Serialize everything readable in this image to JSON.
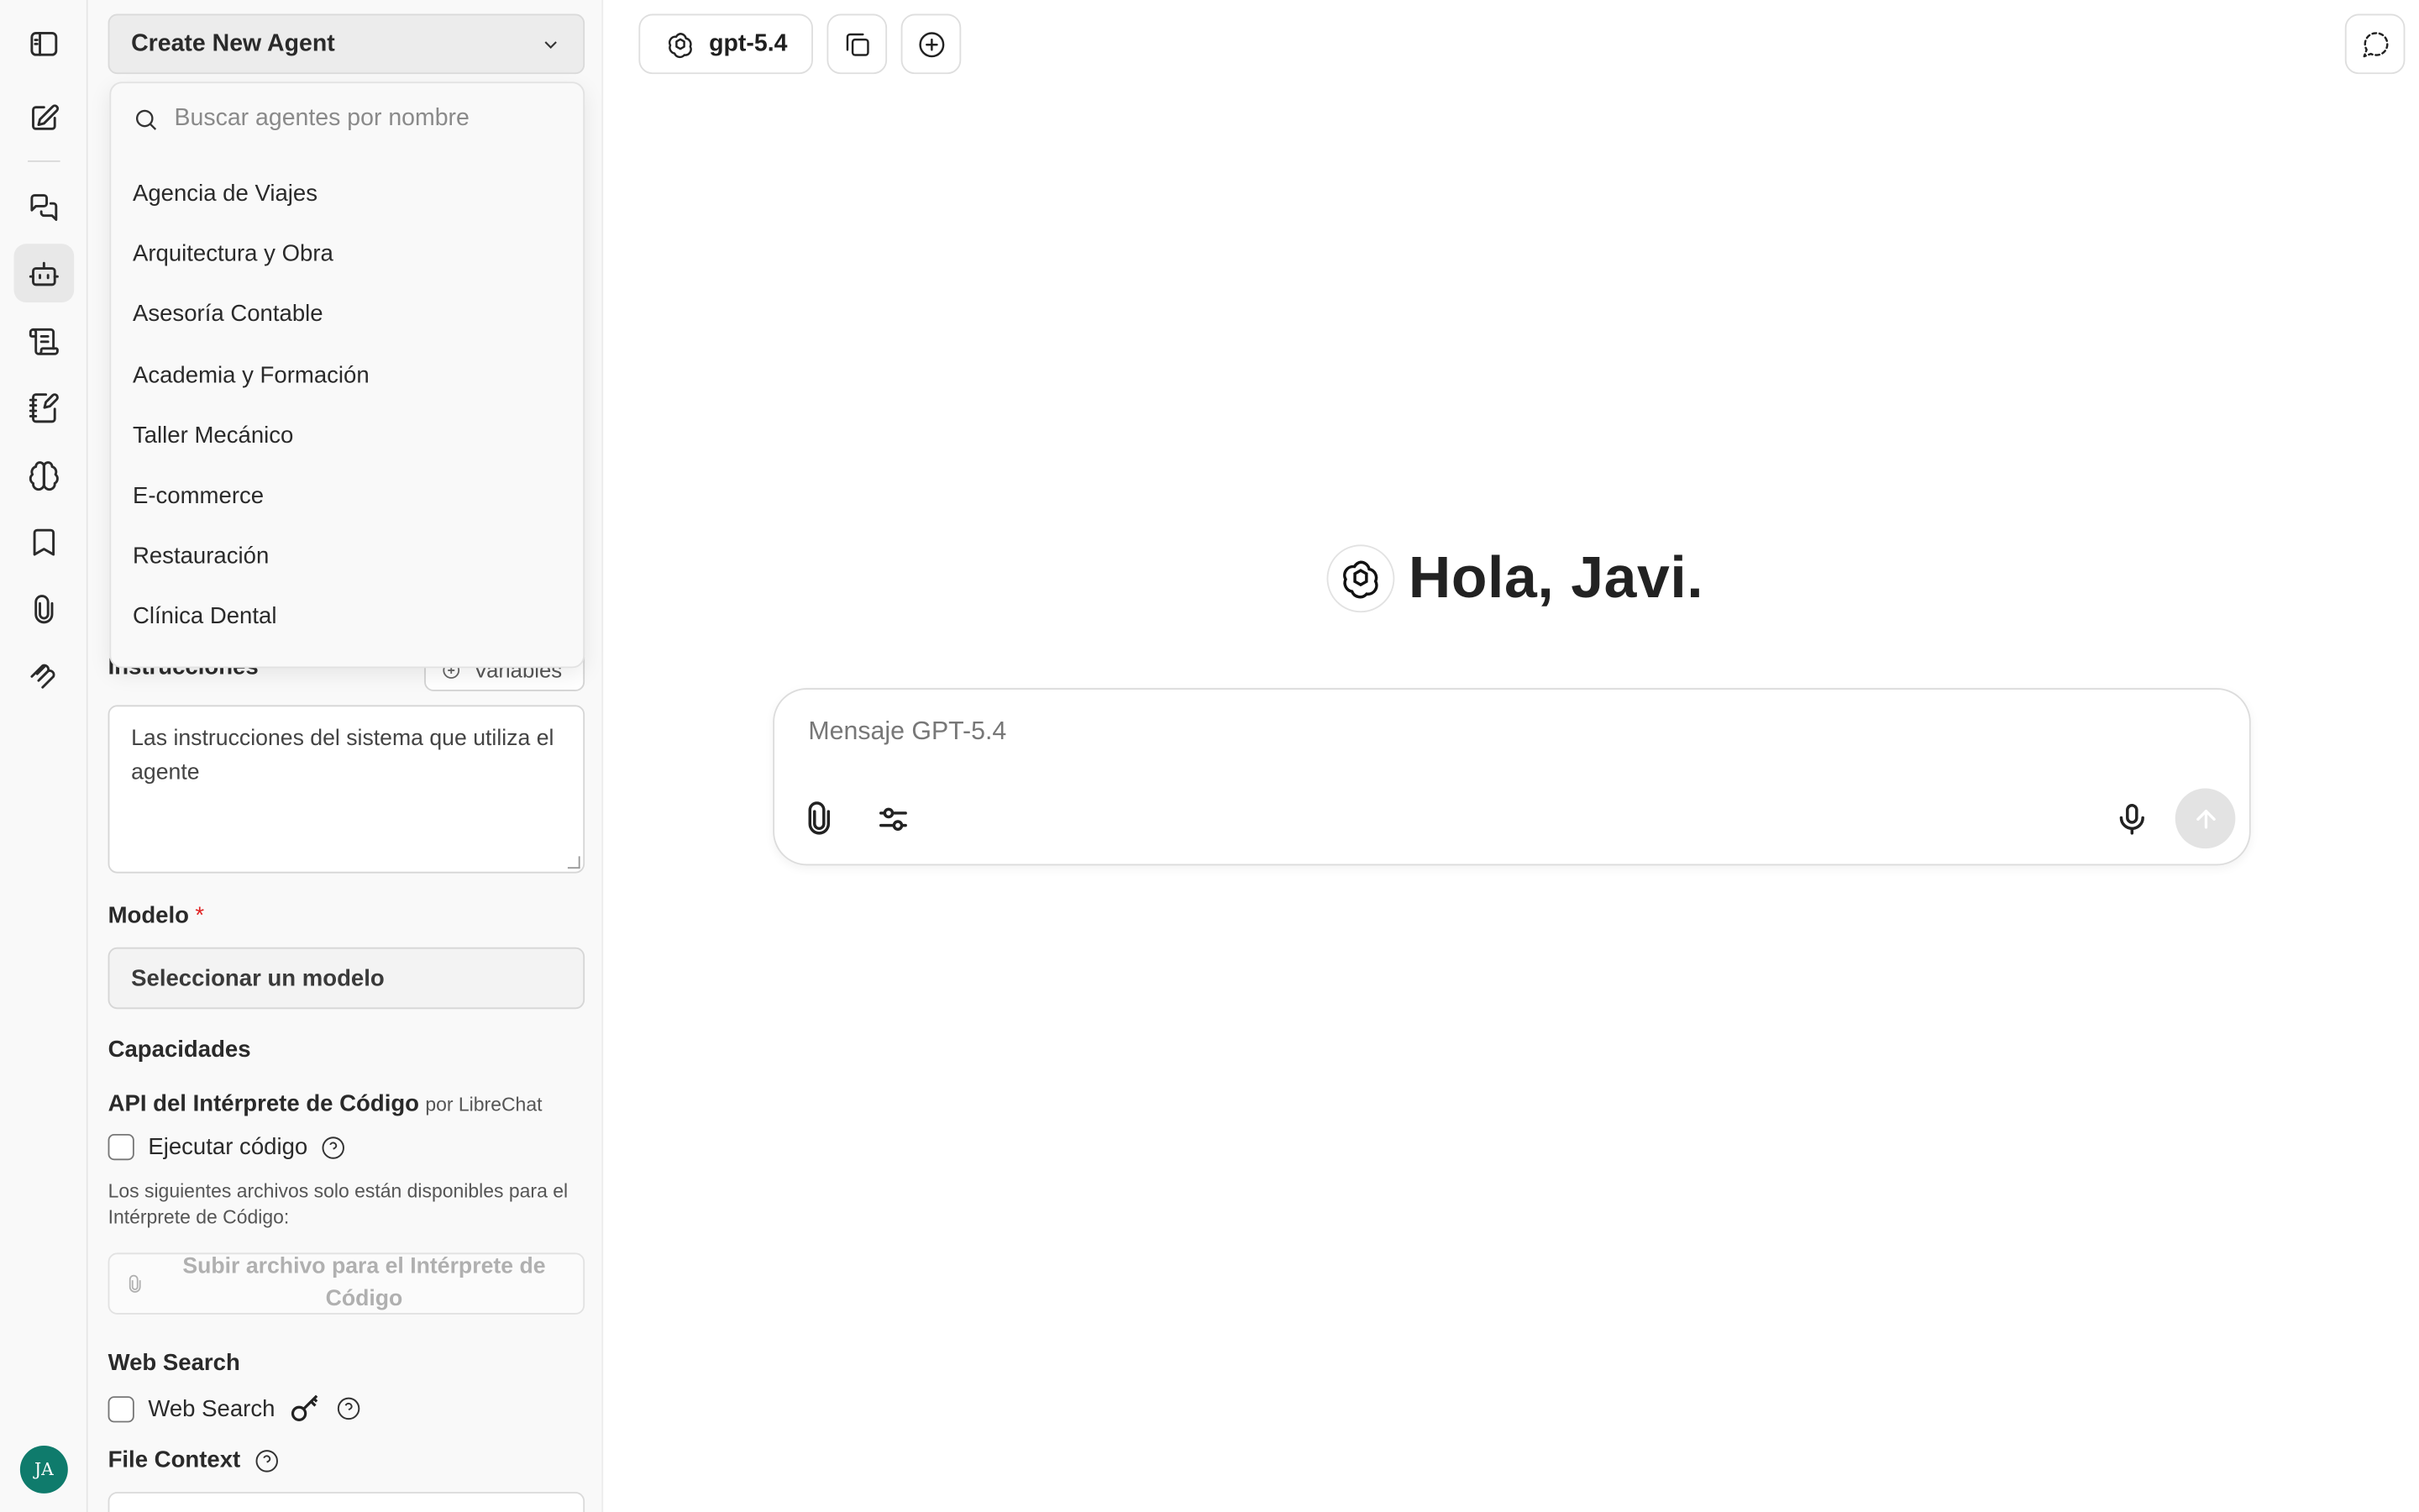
{
  "agent_panel": {
    "agent_select_label": "Create New Agent",
    "instructions_label": "Instrucciones",
    "variables_label": "Variables",
    "instructions_placeholder": "Las instrucciones del sistema que utiliza el agente",
    "model_label": "Modelo",
    "required_mark": "*",
    "model_select": "Seleccionar un modelo",
    "capabilities_label": "Capacidades",
    "code_api_label": "API del Intérprete de Código",
    "code_api_by": "por LibreChat",
    "run_code_label": "Ejecutar código",
    "files_note": "Los siguientes archivos solo están disponibles para el Intérprete de Código:",
    "upload_label": "Subir archivo para el Intérprete de Código",
    "web_search_title": "Web Search",
    "web_search_label": "Web Search",
    "file_context_label": "File Context"
  },
  "dropdown": {
    "search_placeholder": "Buscar agentes por nombre",
    "items": [
      "Agencia de Viajes",
      "Arquitectura y Obra",
      "Asesoría Contable",
      "Academia y Formación",
      "Taller Mecánico",
      "E-commerce",
      "Restauración",
      "Clínica Dental"
    ]
  },
  "topbar": {
    "model_name": "gpt-5.4"
  },
  "main": {
    "greeting": "Hola, Javi.",
    "composer_placeholder": "Mensaje GPT-5.4"
  },
  "user": {
    "initials": "JA"
  },
  "icons": {
    "rail": [
      "sidebar-toggle-icon",
      "new-chat-icon",
      "chats-icon",
      "agents-icon",
      "prompts-icon",
      "memories-icon",
      "brain-icon",
      "bookmarks-icon",
      "attachments-icon",
      "mcp-icon"
    ]
  },
  "colors": {
    "avatar_bg": "#0f7b6c",
    "required": "#e02424",
    "panel_bg": "#f9f9f9"
  }
}
